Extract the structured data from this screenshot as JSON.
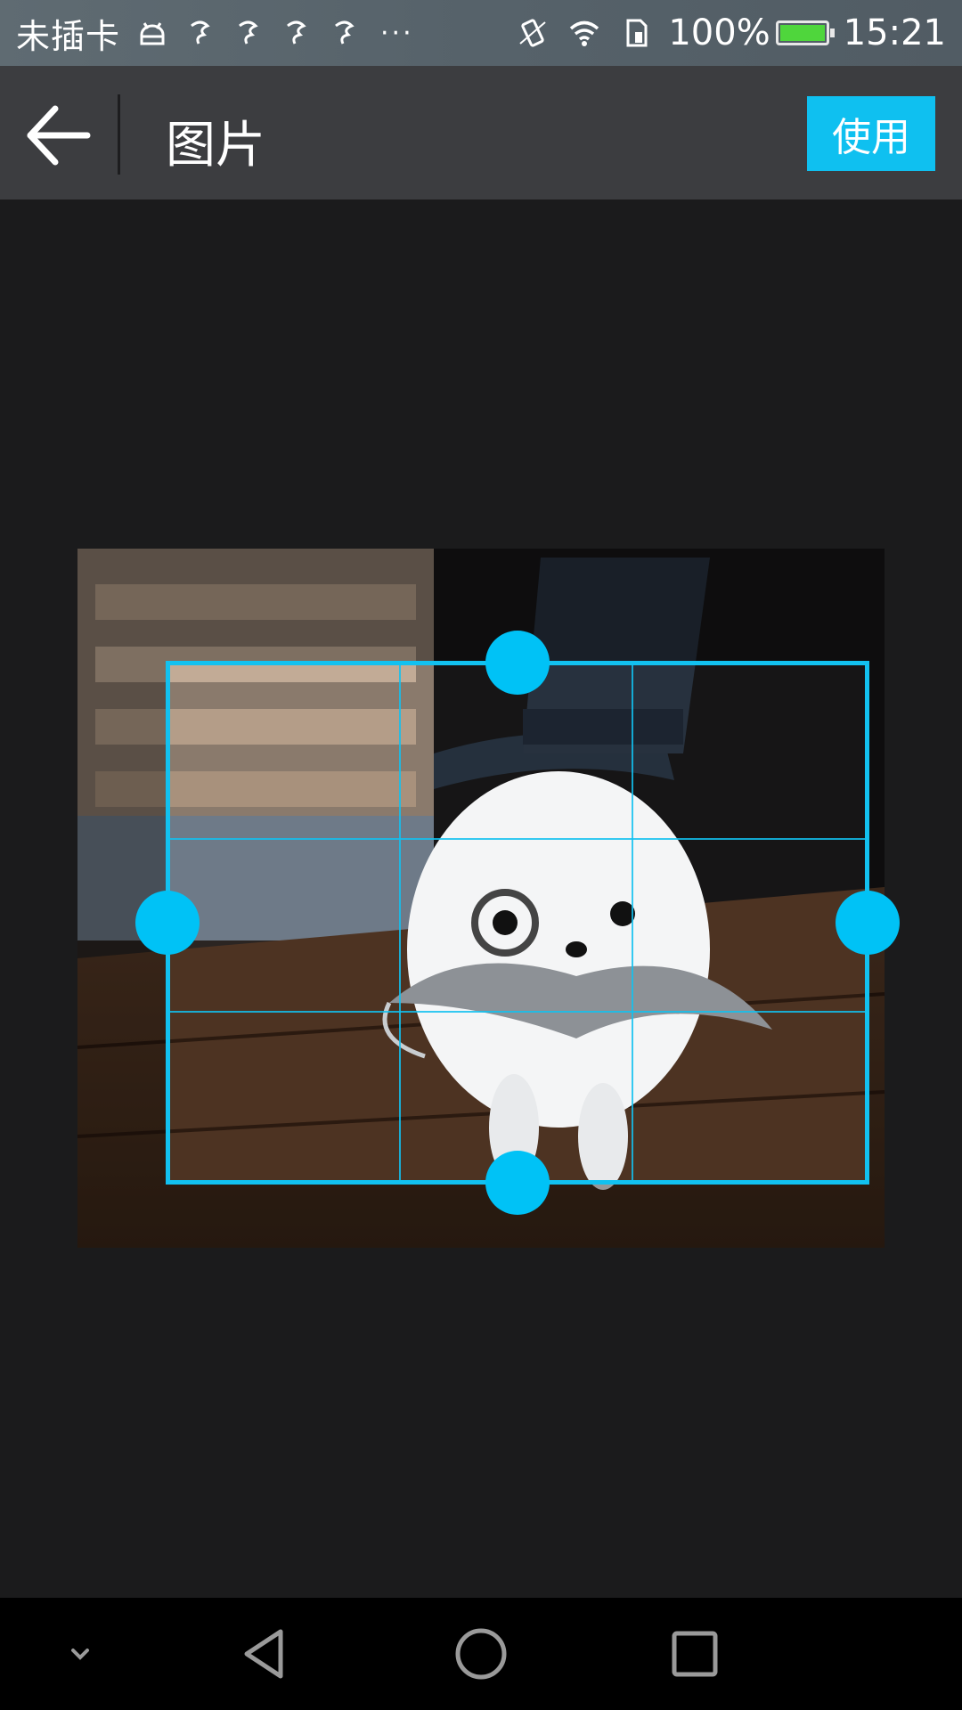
{
  "status_bar": {
    "carrier": "未插卡",
    "battery_percent": "100%",
    "time": "15:21",
    "left_icons": [
      "android-icon",
      "notification-app-icon",
      "notification-app-icon",
      "notification-app-icon",
      "notification-app-icon"
    ],
    "overflow": "···",
    "right_icons": [
      "vibrate-icon",
      "wifi-icon",
      "sim-icon",
      "battery-charging-icon"
    ]
  },
  "header": {
    "title": "图片",
    "use_label": "使用",
    "back_icon": "arrow-left-icon"
  },
  "cropper": {
    "grid_lines": 2,
    "accent_color": "#00c2f6",
    "handles": [
      "top",
      "left",
      "right",
      "bottom"
    ]
  },
  "nav_bar": {
    "buttons": [
      "chevron-down-icon",
      "back-triangle-icon",
      "home-circle-icon",
      "recents-square-icon"
    ]
  }
}
